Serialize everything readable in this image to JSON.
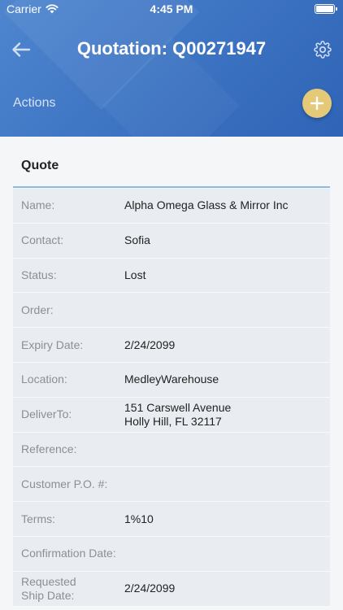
{
  "status_bar": {
    "carrier": "Carrier",
    "time": "4:45 PM"
  },
  "header": {
    "title": "Quotation: Q00271947",
    "actions_label": "Actions",
    "colors": {
      "gradient_start": "#4f86cf",
      "gradient_end": "#2f63b6",
      "add_button": "#e3c978"
    },
    "icons": {
      "back": "back-arrow-icon",
      "settings": "gear-icon",
      "add": "plus-icon"
    }
  },
  "section": {
    "title": "Quote",
    "divider_color": "#8cbbe0"
  },
  "fields": [
    {
      "label": "Name:",
      "value": "Alpha Omega Glass & Mirror Inc"
    },
    {
      "label": "Contact:",
      "value": "Sofia"
    },
    {
      "label": "Status:",
      "value": "Lost"
    },
    {
      "label": "Order:",
      "value": ""
    },
    {
      "label": "Expiry Date:",
      "value": "2/24/2099"
    },
    {
      "label": "Location:",
      "value": "MedleyWarehouse"
    },
    {
      "label": "DeliverTo:",
      "value": "151 Carswell Avenue",
      "value_line2": "Holly Hill, FL 32117"
    },
    {
      "label": "Reference:",
      "value": ""
    },
    {
      "label": "Customer P.O. #:",
      "value": ""
    },
    {
      "label": "Terms:",
      "value": "1%10"
    },
    {
      "label": "Confirmation Date:",
      "value": ""
    },
    {
      "label": "Requested",
      "label_line2": "Ship Date:",
      "value": "2/24/2099"
    }
  ]
}
